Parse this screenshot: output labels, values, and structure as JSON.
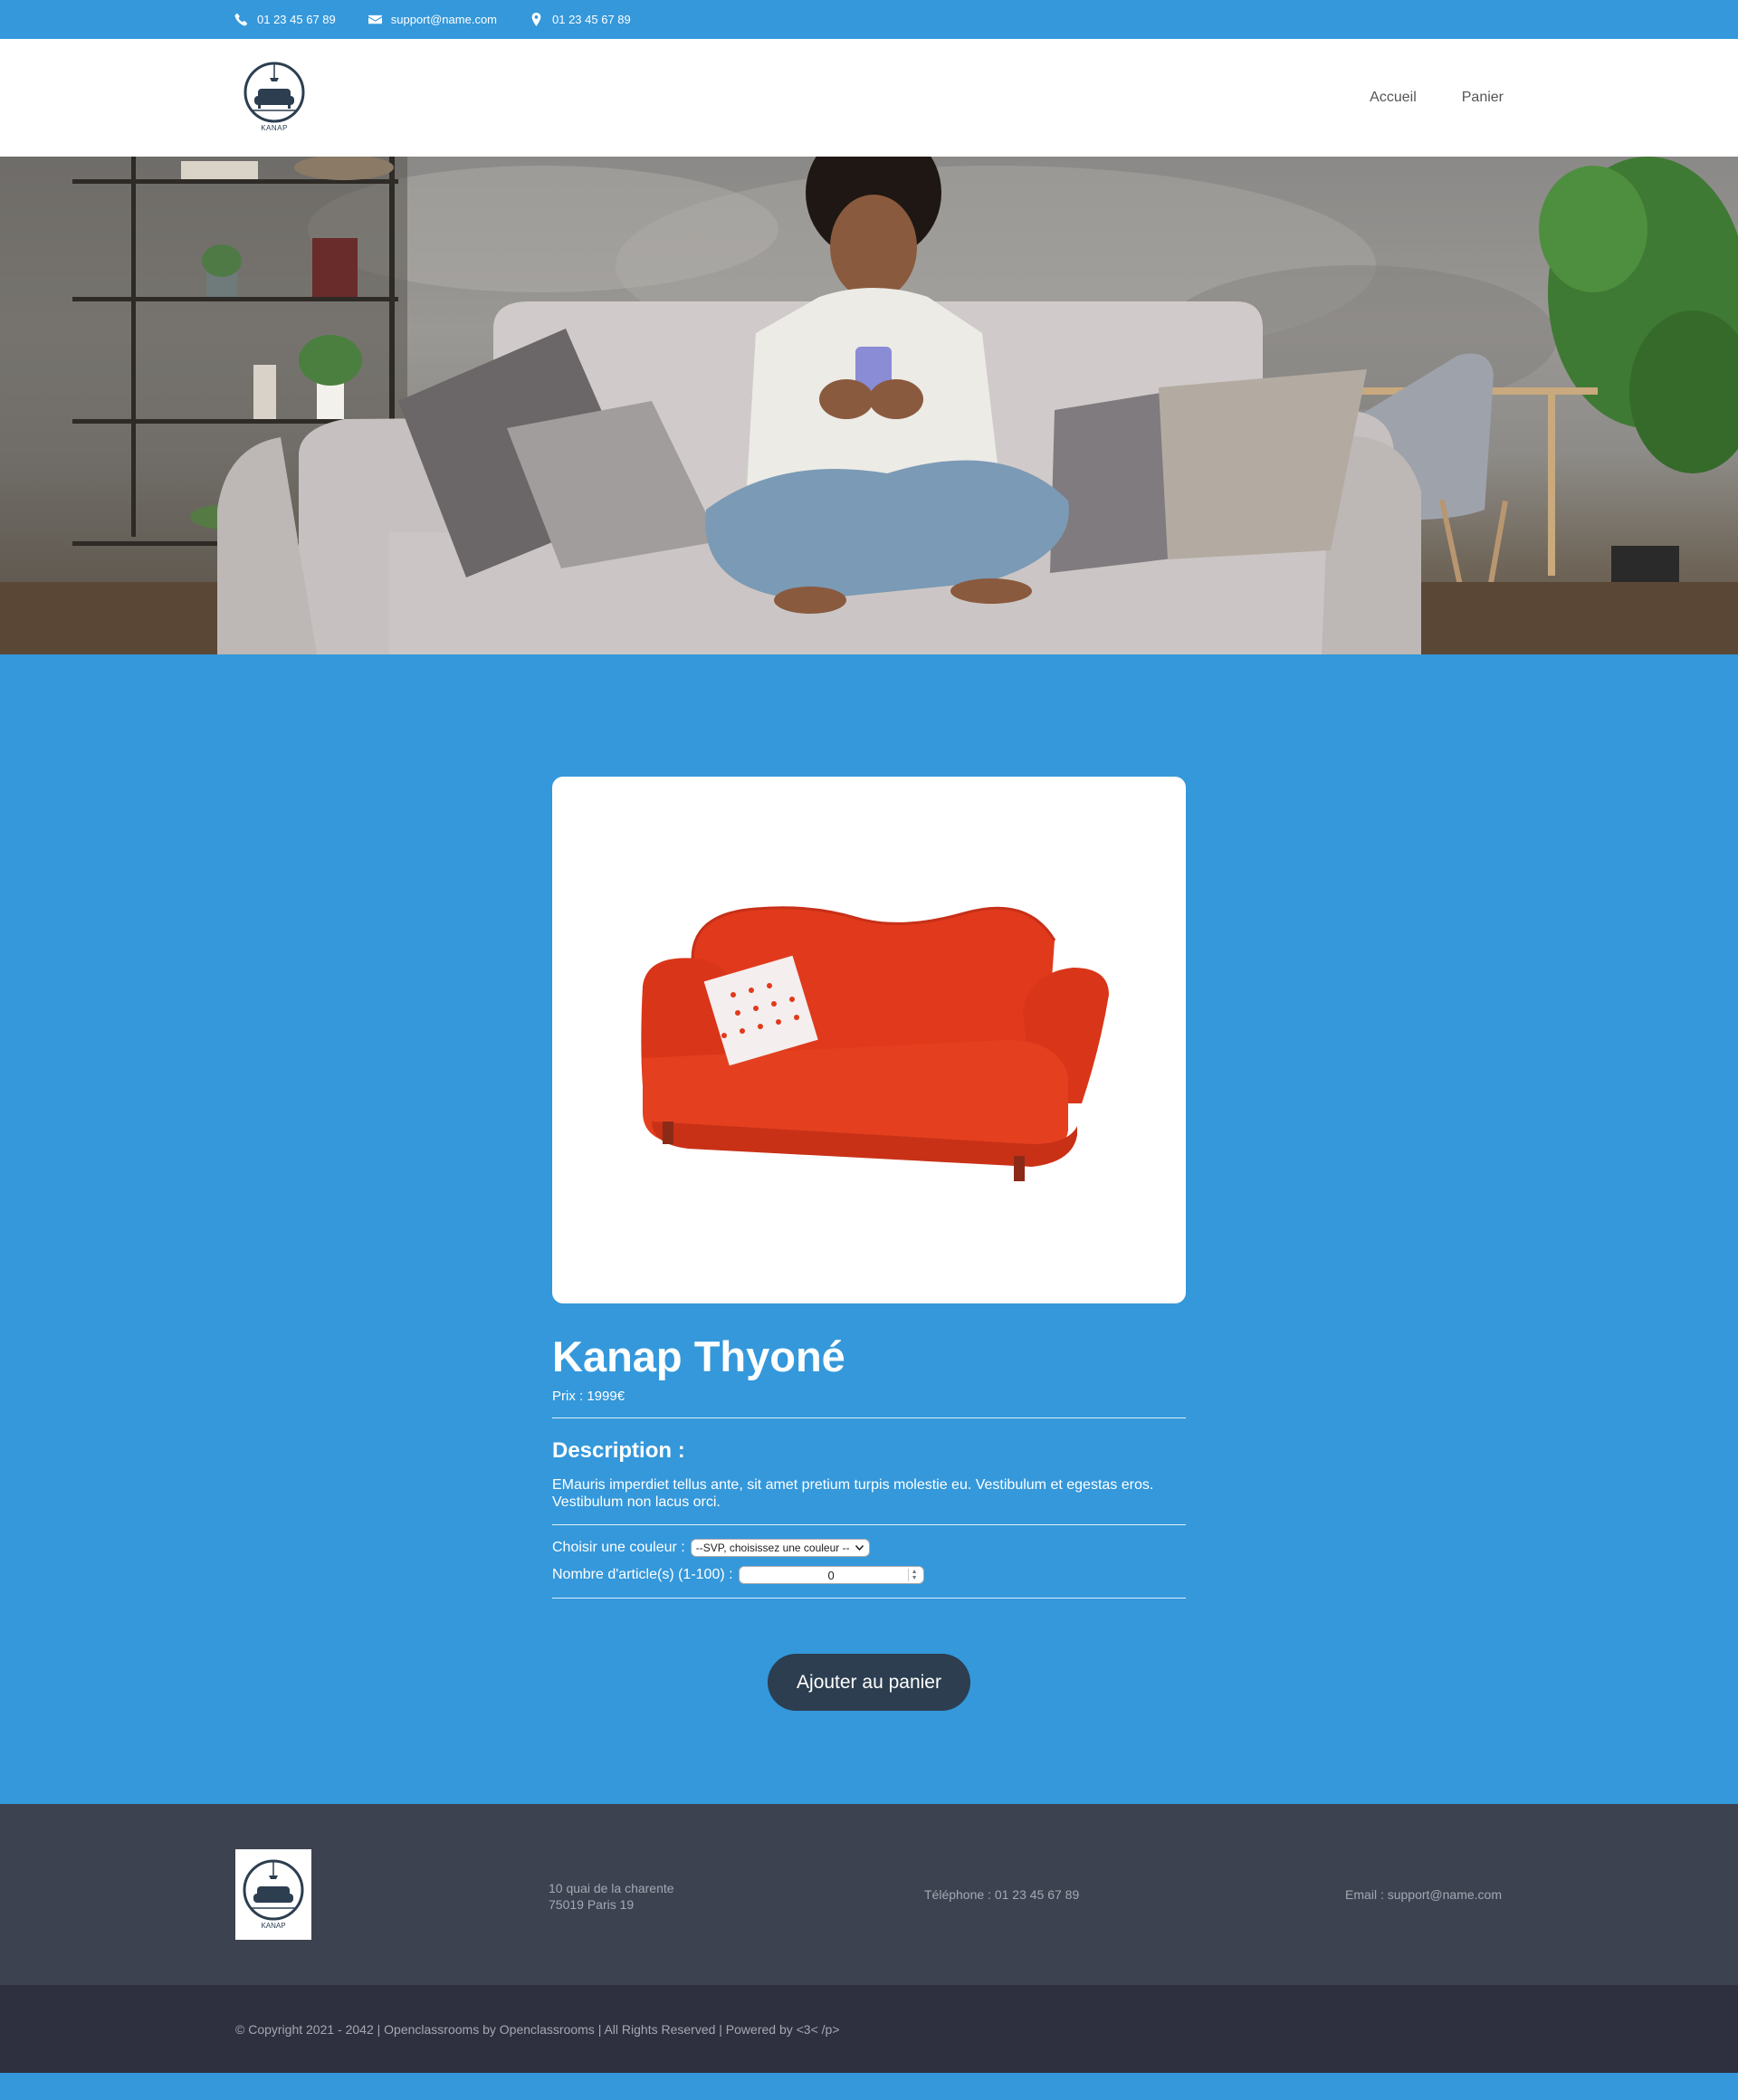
{
  "topbar": {
    "phone": "01 23 45 67 89",
    "email": "support@name.com",
    "location": "01 23 45 67 89"
  },
  "header": {
    "logo_text": "KANAP",
    "nav": [
      "Accueil",
      "Panier"
    ]
  },
  "product": {
    "title": "Kanap Thyoné",
    "price": "Prix : 1999€",
    "description_title": "Description :",
    "description": "EMauris imperdiet tellus ante, sit amet pretium turpis molestie eu. Vestibulum et egestas eros. Vestibulum non lacus orci.",
    "color_label": "Choisir une couleur :",
    "color_selected": "--SVP, choisissez une couleur --",
    "quantity_label": "Nombre d'article(s) (1-100) :",
    "quantity_value": "0",
    "add_button": "Ajouter au panier"
  },
  "footer": {
    "logo_text": "KANAP",
    "address_line1": "10 quai de la charente",
    "address_line2": "75019 Paris 19",
    "telephone": "Téléphone : 01 23 45 67 89",
    "email": "Email : support@name.com",
    "copyright": "© Copyright 2021 - 2042 | Openclassrooms by Openclassrooms | All Rights Reserved | Powered by <3< /p>"
  },
  "colors": {
    "primary_blue": "#3498db",
    "dark_button": "#2c3e50",
    "footer_bg": "#3d4250",
    "copyright_bg": "#2e303f",
    "sofa_red": "#e0391c"
  },
  "icons": [
    "phone-icon",
    "envelope-icon",
    "map-marker-icon",
    "kanap-logo"
  ]
}
